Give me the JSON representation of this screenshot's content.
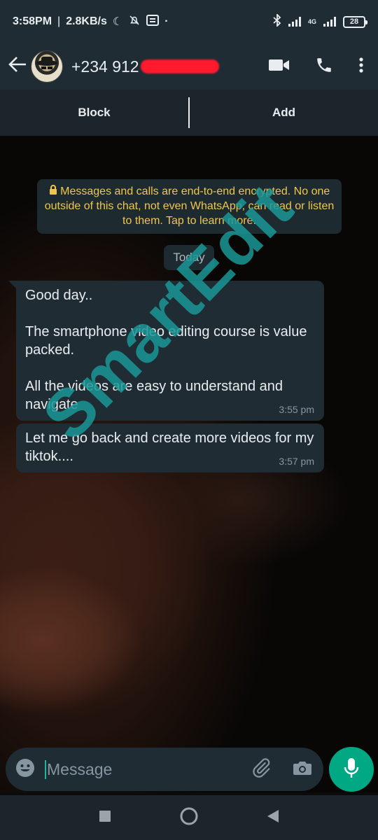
{
  "status_bar": {
    "time": "3:58PM",
    "speed": "2.8KB/s",
    "separator": "|",
    "dot": "·",
    "network_label": "4G",
    "battery": "28"
  },
  "header": {
    "contact_number": "+234 912",
    "back_icon": "back-arrow-icon",
    "video_icon": "video-call-icon",
    "call_icon": "phone-icon",
    "menu_icon": "more-vert-icon"
  },
  "contact_actions": {
    "block_label": "Block",
    "add_label": "Add"
  },
  "chat": {
    "encryption_notice": "Messages and calls are end-to-end encrypted. No one outside of this chat, not even WhatsApp, can read or listen to them. Tap to learn more.",
    "date_chip": "Today",
    "messages": [
      {
        "text": "Good day..\n\nThe smartphone video editing course is value packed.\n\nAll the videos are easy to understand and navigate",
        "time": "3:55 pm"
      },
      {
        "text": "Let me go back and create more videos for my tiktok....",
        "time": "3:57 pm"
      }
    ],
    "watermark": "SmartEdit"
  },
  "composer": {
    "placeholder": "Message",
    "emoji_icon": "emoji-icon",
    "attach_icon": "paperclip-icon",
    "camera_icon": "camera-icon",
    "mic_icon": "mic-icon"
  },
  "colors": {
    "accent": "#00a884",
    "bar": "#1f2c34",
    "bubble": "#202c33",
    "notice_text": "#f0c64e",
    "watermark": "#1a9696"
  }
}
